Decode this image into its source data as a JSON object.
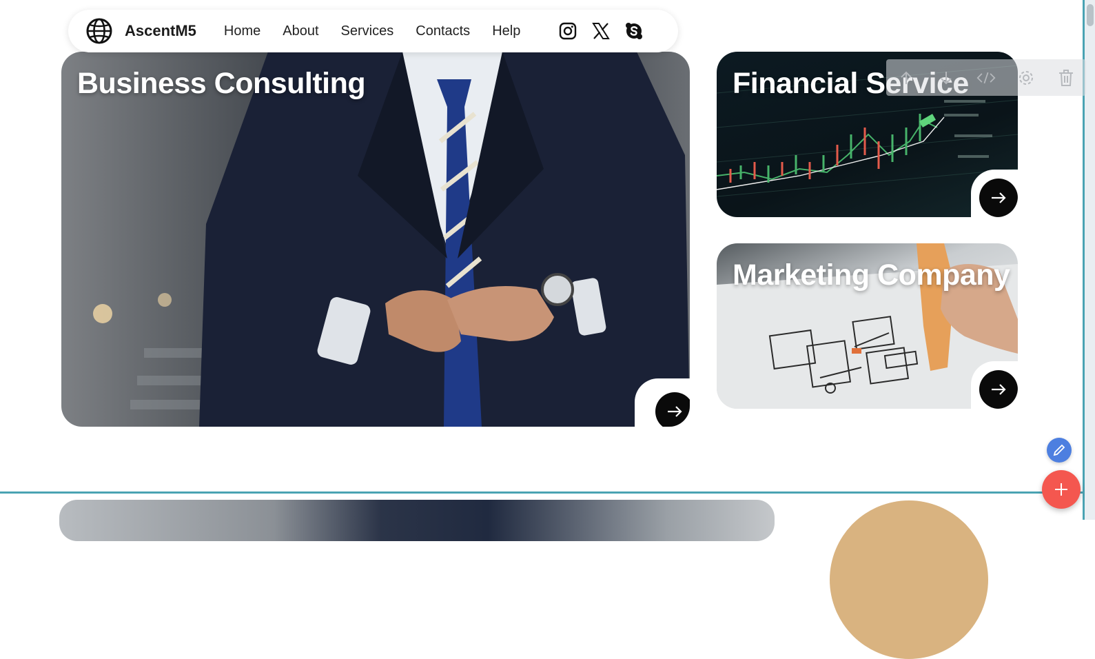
{
  "nav": {
    "brand": "AscentM5",
    "links": [
      "Home",
      "About",
      "Services",
      "Contacts",
      "Help"
    ],
    "socials": [
      "instagram-icon",
      "x-icon",
      "skype-icon"
    ]
  },
  "cards": [
    {
      "title": "Business Consulting",
      "image": "businessman-in-suit",
      "arrow": "arrow-right-icon"
    },
    {
      "title": "Financial Service",
      "image": "stock-chart-screen",
      "arrow": "arrow-right-icon"
    },
    {
      "title": "Marketing Company",
      "image": "hand-drawing-wireframe",
      "arrow": "arrow-right-icon"
    }
  ],
  "toolbar": {
    "icons": [
      "move-up-icon",
      "move-down-icon",
      "code-icon",
      "gear-icon",
      "trash-icon"
    ]
  },
  "fabs": {
    "edit": "pencil-icon",
    "add": "plus-icon"
  },
  "colors": {
    "accent_line": "#4aa3b3",
    "add_button": "#f4574f",
    "edit_button": "#4d7fe0",
    "arrow_button": "#0a0a0a"
  }
}
